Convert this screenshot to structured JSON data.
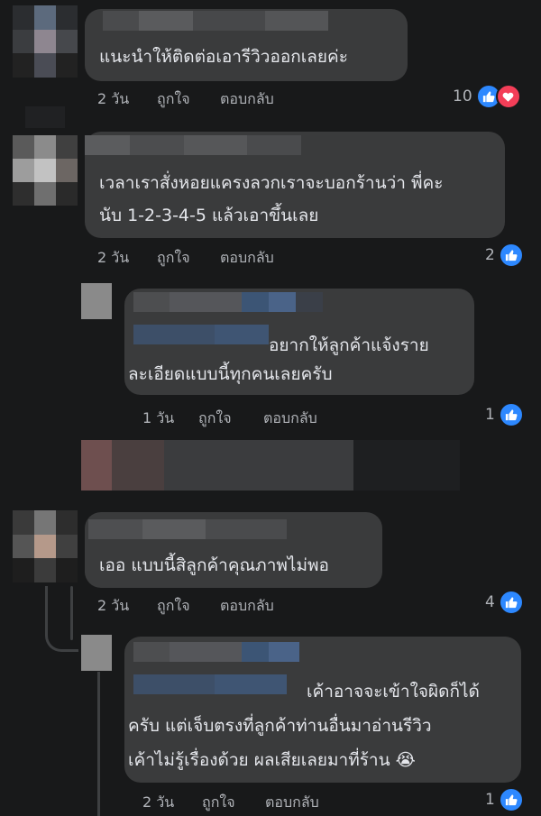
{
  "comments": [
    {
      "text_lines": [
        "แนะนำให้ติดต่อเอารีวิวออกเลยค่ะ"
      ],
      "time": "2 วัน",
      "like_label": "ถูกใจ",
      "reply_label": "ตอบกลับ",
      "reaction_count": "10",
      "reaction_icons": [
        "like-icon",
        "heart-icon"
      ]
    },
    {
      "text_lines": [
        "เวลาเราสั่งหอยแครงลวกเราจะบอกร้านว่า พี่คะ",
        "นับ 1-2-3-4-5 แล้วเอาขึ้นเลย"
      ],
      "time": "2 วัน",
      "like_label": "ถูกใจ",
      "reply_label": "ตอบกลับ",
      "reaction_count": "2",
      "reaction_icons": [
        "like-icon"
      ]
    },
    {
      "text_lines": [
        "อยากให้ลูกค้าแจ้งราย",
        "ละเอียดแบบนี้ทุกคนเลยครับ"
      ],
      "time": "1 วัน",
      "like_label": "ถูกใจ",
      "reply_label": "ตอบกลับ",
      "reaction_count": "1",
      "reaction_icons": [
        "like-icon"
      ]
    },
    {
      "text_lines": [
        "เออ แบบนี้สิลูกค้าคุณภาพไม่พอ"
      ],
      "time": "2 วัน",
      "like_label": "ถูกใจ",
      "reply_label": "ตอบกลับ",
      "reaction_count": "4",
      "reaction_icons": [
        "like-icon"
      ]
    },
    {
      "text_lines": [
        "เค้าอาจจะเข้าใจผิดก็ได้",
        "ครับ แต่เจ็บตรงที่ลูกค้าท่านอื่นมาอ่านรีวิว",
        "เค้าไม่รู้เรื่องด้วย ผลเสียเลยมาที่ร้าน 😭"
      ],
      "time": "2 วัน",
      "like_label": "ถูกใจ",
      "reply_label": "ตอบกลับ",
      "reaction_count": "1",
      "reaction_icons": [
        "like-icon"
      ]
    }
  ],
  "colors": {
    "background": "#18191a",
    "bubble": "#3a3b3c",
    "text": "#e4e6eb",
    "meta": "#b0b3b8",
    "like_blue": "#2d88ff",
    "love_red": "#f33e58"
  }
}
